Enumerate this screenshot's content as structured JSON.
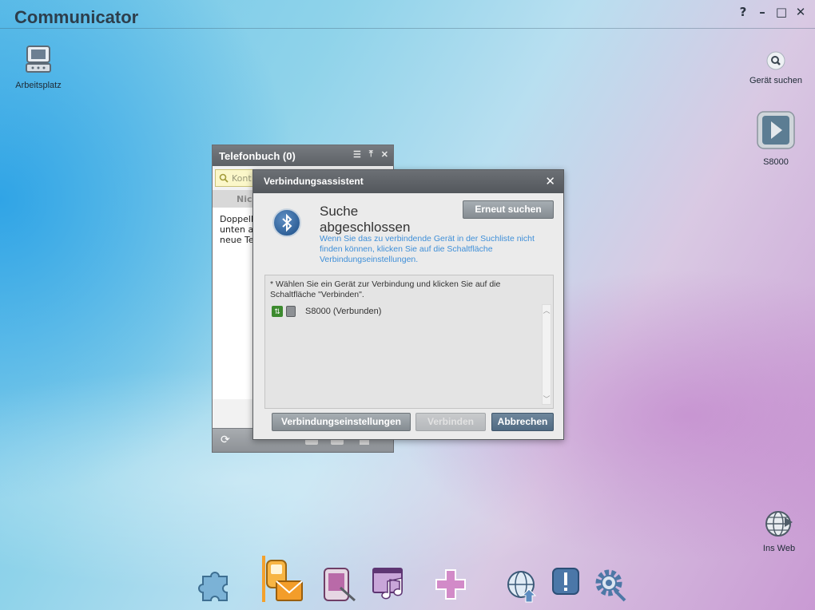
{
  "app": {
    "title": "Communicator",
    "controls": [
      "?",
      "–",
      "□",
      "✕"
    ]
  },
  "desktop": {
    "my_computer": "Arbeitsplatz",
    "search_device": "Gerät suchen",
    "device": "S8000",
    "web": "Ins Web"
  },
  "phonebook": {
    "title": "Telefonbuch (0)",
    "search_placeholder": "Kont",
    "column": "Nick",
    "body_lines": [
      "Doppelkl",
      "unten au",
      "neue Tel"
    ]
  },
  "dialog": {
    "title": "Verbindungsassistent",
    "status_title": "Suche abgeschlossen",
    "hint": "Wenn Sie das zu verbindende Gerät in der Suchliste nicht finden können, klicken Sie auf die Schaltfläche Verbindungseinstellungen.",
    "research_button": "Erneut suchen",
    "instruction": "* Wählen Sie ein Gerät zur Verbindung und klicken Sie auf die Schaltfläche \"Verbinden\".",
    "devices": [
      {
        "label": "S8000 (Verbunden)"
      }
    ],
    "settings_button": "Verbindungseinstellungen",
    "connect_button": "Verbinden",
    "cancel_button": "Abbrechen"
  },
  "dock": {
    "items": [
      {
        "icon": "puzzle-icon"
      },
      {
        "icon": "phone-message-icon",
        "active": true
      },
      {
        "icon": "pda-icon"
      },
      {
        "icon": "media-icon"
      },
      {
        "icon": "plus-icon"
      },
      {
        "icon": "globe-upload-icon"
      },
      {
        "icon": "alert-icon"
      },
      {
        "icon": "settings-gear-icon"
      }
    ]
  }
}
